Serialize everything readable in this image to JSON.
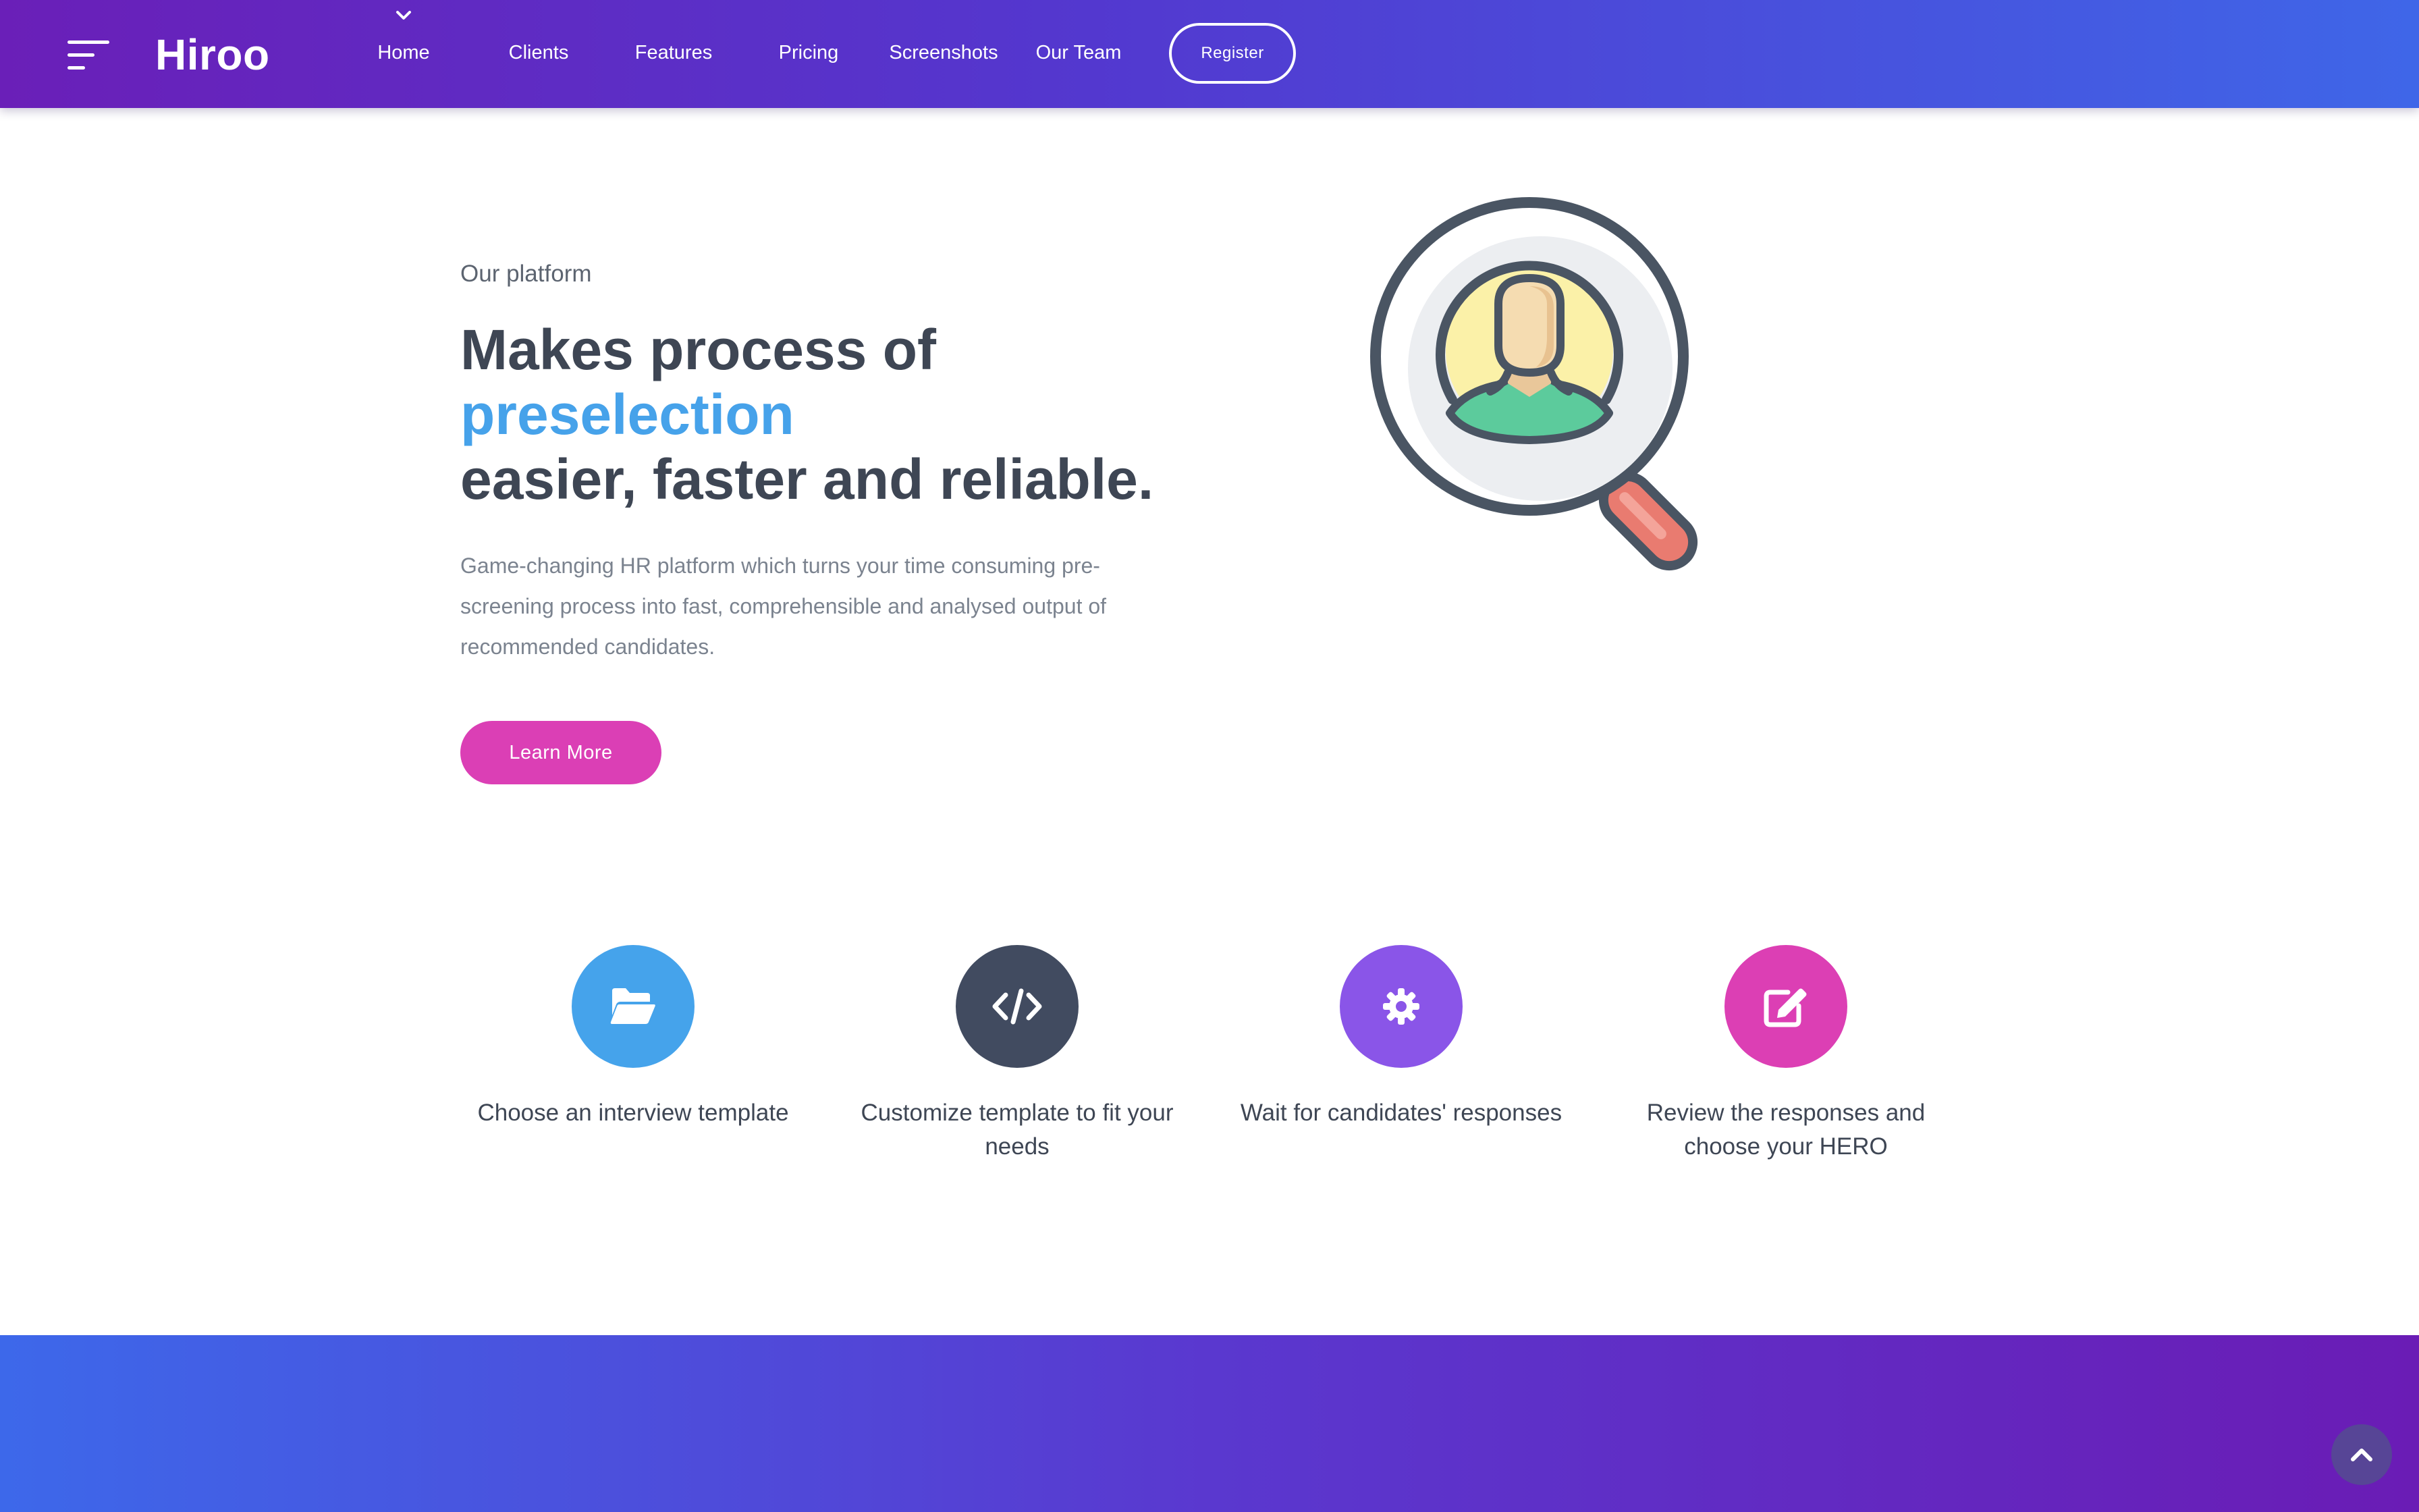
{
  "header": {
    "brand": "Hiroo",
    "nav": [
      {
        "label": "Home",
        "active": true
      },
      {
        "label": "Clients"
      },
      {
        "label": "Features"
      },
      {
        "label": "Pricing"
      },
      {
        "label": "Screenshots"
      },
      {
        "label": "Our Team"
      }
    ],
    "register_label": "Register",
    "menu_icon": "hamburger-menu-icon",
    "active_icon": "chevron-down-icon"
  },
  "hero": {
    "eyebrow": "Our platform",
    "headline_line1": "Makes process of",
    "headline_highlight": "preselection",
    "headline_line3": "easier, faster and reliable.",
    "description": "Game-changing HR platform which turns your time consuming pre-screening process into fast, comprehensible and analysed output of recommended candidates.",
    "cta_label": "Learn More",
    "illustration_icon": "magnifier-candidate-icon"
  },
  "steps": [
    {
      "label": "Choose an interview template",
      "icon": "folder-open-icon",
      "color": "#45a3eb"
    },
    {
      "label": "Customize template to fit your needs",
      "icon": "code-icon",
      "color": "#414b60"
    },
    {
      "label": "Wait for candidates' responses",
      "icon": "gear-icon",
      "color": "#8a55e8"
    },
    {
      "label": "Review the responses and choose your HERO",
      "icon": "edit-icon",
      "color": "#dc3fb4"
    }
  ],
  "colors": {
    "accent_blue": "#46a2ea",
    "cta_pink": "#db3fb5",
    "header_gradient_start": "#6a1fb8",
    "header_gradient_end": "#3f66e8"
  },
  "scroll_top_icon": "chevron-up-icon"
}
